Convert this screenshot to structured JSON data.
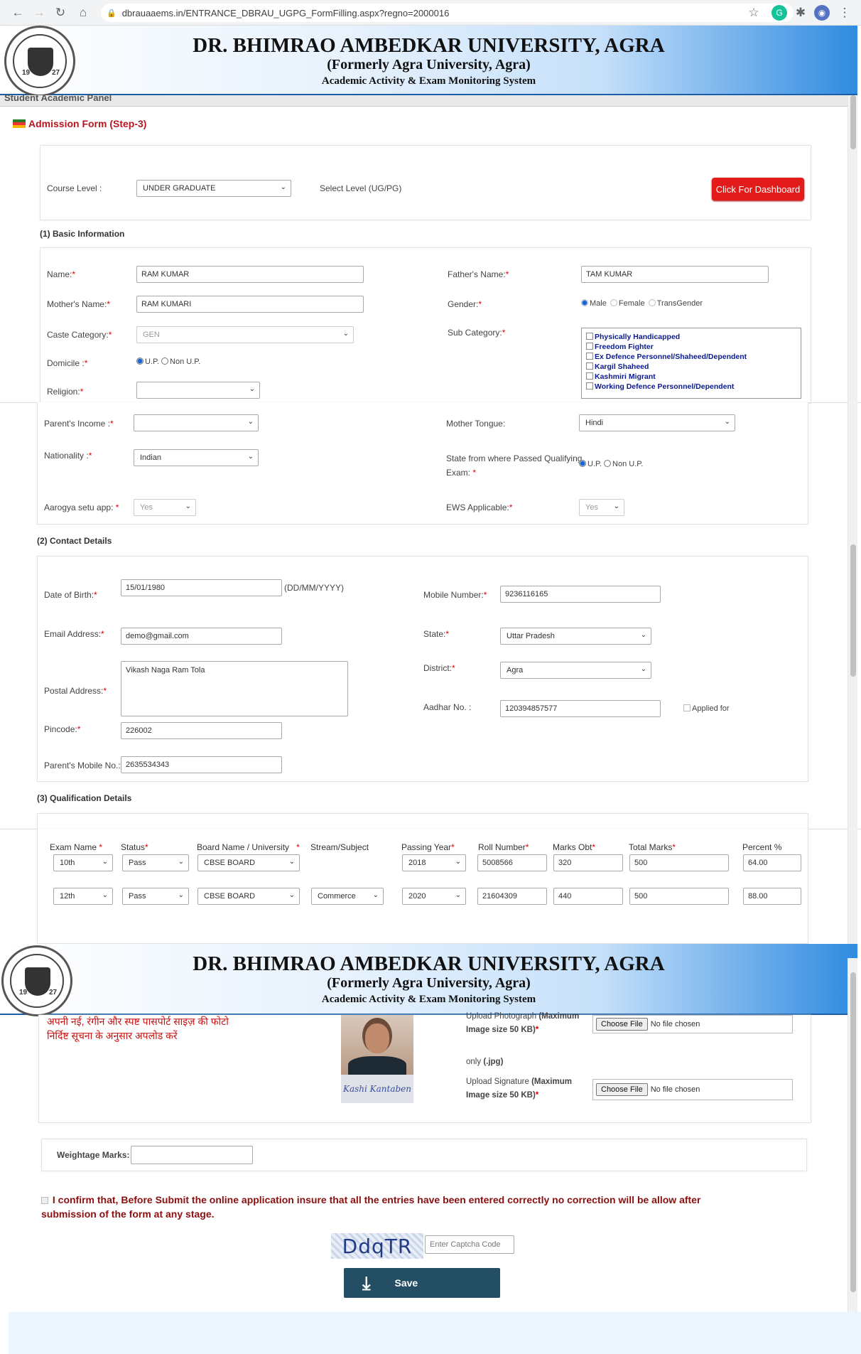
{
  "browser": {
    "url": "dbrauaaems.in/ENTRANCE_DBRAU_UGPG_FormFilling.aspx?regno=2000016"
  },
  "header": {
    "university": "DR. BHIMRAO AMBEDKAR UNIVERSITY, AGRA",
    "formerly": "(Formerly Agra University, Agra)",
    "system": "Academic Activity & Exam Monitoring System",
    "logo_year_left": "19",
    "logo_year_right": "27"
  },
  "panel_title": "Student Academic Panel",
  "form_title": "Admission Form (Step-3)",
  "course": {
    "label": "Course Level :",
    "value": "UNDER GRADUATE",
    "hint": "Select Level (UG/PG)",
    "dashboard_button": "Click For Dashboard"
  },
  "basic": {
    "title": "(1) Basic Information",
    "name_label": "Name:",
    "name": "RAM KUMAR",
    "father_label": "Father's Name:",
    "father": "TAM KUMAR",
    "mother_label": "Mother's Name:",
    "mother": "RAM KUMARI",
    "gender_label": "Gender:",
    "gender_male": "Male",
    "gender_female": "Female",
    "gender_trans": "TransGender",
    "caste_label": "Caste Category:",
    "caste": "GEN",
    "subcat_label": "Sub Category:",
    "subcats": [
      "Physically Handicapped",
      "Freedom Fighter",
      "Ex Defence Personnel/Shaheed/Dependent",
      "Kargil Shaheed",
      "Kashmiri Migrant",
      "Working Defence Personnel/Dependent"
    ],
    "domicile_label": "Domicile :",
    "domicile_up": "U.P.",
    "domicile_nonup": "Non U.P.",
    "religion_label": "Religion:",
    "religion": "",
    "income_label": "Parent's Income :",
    "income": "",
    "tongue_label": "Mother Tongue:",
    "tongue": "Hindi",
    "nationality_label": "Nationality :",
    "nationality": "Indian",
    "state_passed_label_1": "State from where Passed Qualifying",
    "state_passed_label_2": "Exam:",
    "state_up": "U.P.",
    "state_nonup": "Non U.P.",
    "aarogya_label": "Aarogya setu app:",
    "aarogya": "Yes",
    "ews_label": "EWS Applicable:",
    "ews": "Yes",
    "required_mark": "*"
  },
  "contact": {
    "title": "(2) Contact Details",
    "dob_label": "Date of Birth:",
    "dob": "15/01/1980",
    "dob_format": "(DD/MM/YYYY)",
    "mobile_label": "Mobile Number:",
    "mobile": "9236116165",
    "email_label": "Email Address:",
    "email": "demo@gmail.com",
    "state_label": "State:",
    "state": "Uttar Pradesh",
    "postal_label": "Postal Address:",
    "postal": "Vikash Naga Ram Tola",
    "district_label": "District:",
    "district": "Agra",
    "aadhar_label": "Aadhar No. :",
    "aadhar": "120394857577",
    "applied_for": "Applied for",
    "pincode_label": "Pincode:",
    "pincode": "226002",
    "parent_mobile_label": "Parent's Mobile No.:",
    "parent_mobile": "2635534343"
  },
  "qualification": {
    "title": "(3) Qualification Details",
    "headers": {
      "exam": "Exam Name",
      "status": "Status",
      "board": "Board Name / University",
      "stream": "Stream/Subject",
      "year": "Passing Year",
      "roll": "Roll Number",
      "obt": "Marks Obt",
      "total": "Total Marks",
      "percent": "Percent %"
    },
    "rows": [
      {
        "exam": "10th",
        "status": "Pass",
        "board": "CBSE BOARD",
        "stream": "",
        "year": "2018",
        "roll": "5008566",
        "obt": "320",
        "total": "500",
        "percent": "64.00"
      },
      {
        "exam": "12th",
        "status": "Pass",
        "board": "CBSE BOARD",
        "stream": "Commerce",
        "year": "2020",
        "roll": "21604309",
        "obt": "440",
        "total": "500",
        "percent": "88.00"
      }
    ]
  },
  "uploads": {
    "hindi_line1": "अपनी नई, रंगीन और स्पष्ट पासपोर्ट साइज़ की फोटो",
    "hindi_line2": "निर्दिष्ट सूचना के अनुसार अपलोड करें",
    "photo_label_1": "Upload Photograph",
    "photo_label_1b": "(Maximum",
    "photo_label_2": "Image size 50 KB)",
    "only_jpg_1": "only",
    "only_jpg_2": "(.jpg)",
    "sign_label_1": "Upload Signature",
    "sign_label_1b": "(Maximum",
    "sign_label_2": "Image size 50 KB)",
    "choose_file": "Choose File",
    "no_file": "No file chosen",
    "signature_text": "Kashi Kantaben"
  },
  "weightage": {
    "label": "Weightage Marks:",
    "value": ""
  },
  "confirm": {
    "line1": "I confirm that, Before Submit the online application insure that all the entries have been entered correctly no correction will be allow after",
    "line2": "submission of the form at any stage."
  },
  "captcha": {
    "code": "DdqTR",
    "placeholder": "Enter Captcha Code"
  },
  "save_label": "Save"
}
